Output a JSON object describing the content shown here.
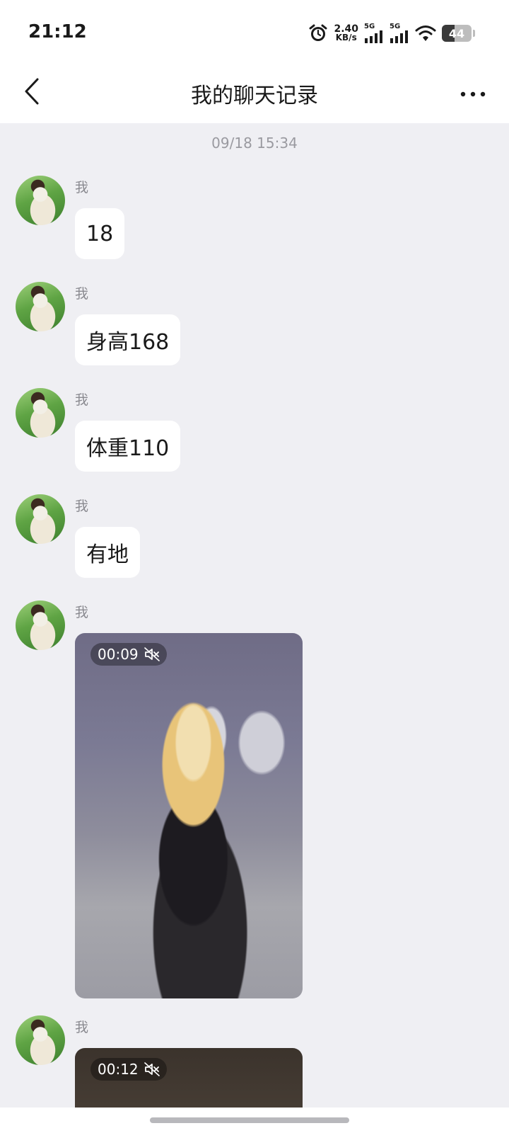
{
  "status_bar": {
    "time": "21:12",
    "net_speed_value": "2.40",
    "net_speed_unit": "KB/s",
    "signal1_label": "5G",
    "signal2_label": "5G",
    "battery_level": "44",
    "icons": [
      "alarm-icon",
      "signal-icon",
      "signal-icon",
      "wifi-icon",
      "battery-icon"
    ]
  },
  "header": {
    "title": "我的聊天记录",
    "back_icon": "chevron-left-icon",
    "more_icon": "more-dots-icon"
  },
  "chat": {
    "timestamp": "09/18 15:34",
    "messages": [
      {
        "sender": "我",
        "type": "text",
        "text": "18"
      },
      {
        "sender": "我",
        "type": "text",
        "text": "身高168"
      },
      {
        "sender": "我",
        "type": "text",
        "text": "体重110"
      },
      {
        "sender": "我",
        "type": "text",
        "text": "有地"
      },
      {
        "sender": "我",
        "type": "video",
        "duration": "00:09"
      },
      {
        "sender": "我",
        "type": "video",
        "duration": "00:12"
      }
    ]
  },
  "colors": {
    "background": "#efeff3",
    "bubble": "#ffffff",
    "meta_text": "#9a9aa0"
  }
}
